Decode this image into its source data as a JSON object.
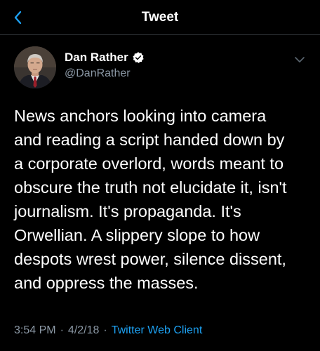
{
  "header": {
    "title": "Tweet",
    "back_icon": "chevron-left-icon",
    "accent": "#1da1f2"
  },
  "tweet": {
    "author": {
      "display_name": "Dan Rather",
      "handle": "@DanRather",
      "verified": true,
      "avatar": "avatar-photo"
    },
    "text": "News anchors looking into camera\nand reading a script handed down by\na corporate overlord, words meant to\nobscure the truth not elucidate it, isn't\njournalism. It's propaganda. It's\nOrwellian. A slippery slope to how\ndespots wrest power, silence dissent,\nand oppress the masses.",
    "time": "3:54 PM",
    "date": "4/2/18",
    "separator": "·",
    "client": "Twitter Web Client"
  },
  "colors": {
    "background": "#000000",
    "text": "#ffffff",
    "muted": "#8b98a5",
    "link": "#1da1f2"
  }
}
